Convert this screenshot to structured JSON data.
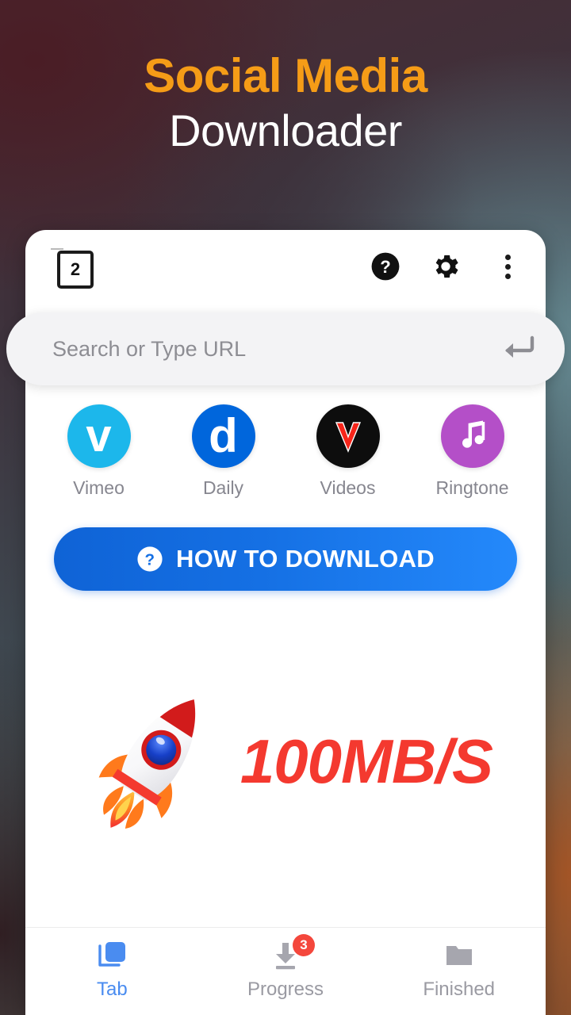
{
  "hero": {
    "title_line1": "Social Media",
    "title_line2": "Downloader",
    "title_color": "#f59c17"
  },
  "toolbar": {
    "tab_count": "2",
    "help_label": "?",
    "icons": {
      "help": "help-circle-icon",
      "settings": "gear-icon",
      "overflow": "more-vertical-icon"
    }
  },
  "search": {
    "value": "",
    "placeholder": "Search or Type URL",
    "enter_icon": "enter-arrow-icon"
  },
  "shortcuts": [
    {
      "label": "Vimeo",
      "glyph": "v",
      "icon": "vimeo-icon",
      "color": "#1cb7eb"
    },
    {
      "label": "Daily",
      "glyph": "d",
      "icon": "dailymotion-icon",
      "color": "#0066dc"
    },
    {
      "label": "Videos",
      "glyph": "V",
      "icon": "videos-icon",
      "color": "#0d0d0d"
    },
    {
      "label": "Ringtone",
      "glyph": "♫",
      "icon": "ringtone-music-note-icon",
      "color": "#b44fc8"
    }
  ],
  "cta": {
    "label": "HOW TO DOWNLOAD",
    "icon": "question-mark-circle-icon",
    "color": "#1570e4"
  },
  "promo": {
    "speed": "100MB/S",
    "speed_color": "#f4392f",
    "illustration": "rocket-icon"
  },
  "bottom_nav": {
    "items": [
      {
        "label": "Tab",
        "icon": "tabs-stack-icon",
        "active": true,
        "badge": ""
      },
      {
        "label": "Progress",
        "icon": "download-arrow-icon",
        "active": false,
        "badge": "3"
      },
      {
        "label": "Finished",
        "icon": "folder-icon",
        "active": false,
        "badge": ""
      }
    ],
    "active_color": "#4a8cf0",
    "badge_color": "#f4473c"
  }
}
